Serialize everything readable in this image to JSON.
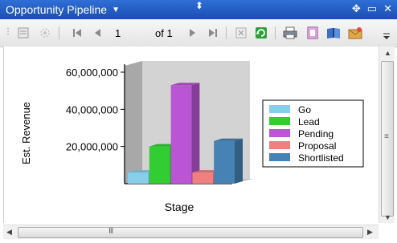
{
  "window": {
    "title": "Opportunity Pipeline",
    "resize_glyph": "⬍",
    "title_buttons": [
      "✥",
      "▭",
      "✕"
    ]
  },
  "toolbar": {
    "page_current": "1",
    "page_of": "of 1"
  },
  "chart_data": {
    "type": "bar",
    "xlabel": "Stage",
    "ylabel": "Est. Revenue",
    "ylim": [
      0,
      60000000
    ],
    "yticks": [
      "60,000,000",
      "40,000,000",
      "20,000,000"
    ],
    "tick_values": [
      60000000,
      40000000,
      20000000
    ],
    "categories": [
      "Go",
      "Lead",
      "Pending",
      "Proposal",
      "Shortlisted"
    ],
    "values": [
      6000000,
      20000000,
      53000000,
      6000000,
      23000000
    ],
    "colors": [
      "#87ceeb",
      "#32cd32",
      "#ba55d3",
      "#f08080",
      "#4682b4"
    ],
    "legend_position": "right",
    "grid": false,
    "style": "3d"
  },
  "scroll": {
    "h_grip": "III",
    "v_grip": "≡"
  }
}
